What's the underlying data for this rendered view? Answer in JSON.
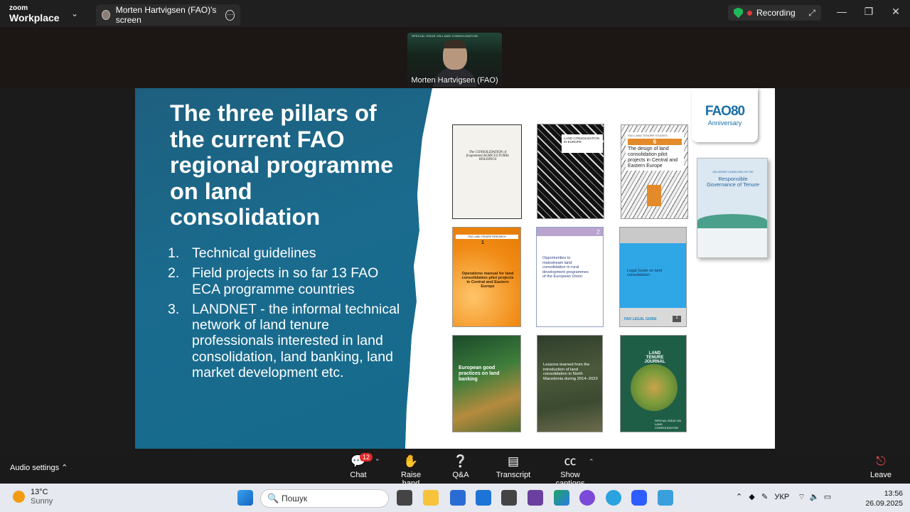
{
  "window": {
    "brand_line1": "zoom",
    "brand_line2": "Workplace",
    "tab_title": "Morten Hartvigsen (FAO)'s screen",
    "recording_label": "Recording"
  },
  "video": {
    "participant_name": "Morten Hartvigsen (FAO)",
    "header_text": "SPECIAL ISSUE ON LAND CONSOLIDATION"
  },
  "slide": {
    "title": "The three pillars of the current FAO regional programme on land consolidation",
    "list": [
      {
        "num": "1.",
        "text": "Technical guidelines"
      },
      {
        "num": "2.",
        "text": "Field projects in so far 13 FAO ECA programme countries"
      },
      {
        "num": "3.",
        "text": "LANDNET - the informal technical network of land tenure professionals interested in land consolidation, land banking, land market development etc."
      }
    ],
    "fao80_logo": "FAO80",
    "fao80_sub": "Anniversary",
    "books": {
      "b1_title": "The CONSOLIDATION of fragmented AGRICULTURAL HOLDINGS",
      "b2_title": "LAND CONSOLIDATION IN EUROPE",
      "b3_series": "FAO LAND TENURE STUDIES",
      "b3_num": "6",
      "b3_title": "The design of land consolidation pilot projects in Central and Eastern Europe",
      "b4_series": "FAO LAND TENURE RESEARCH",
      "b4_num": "1",
      "b4_title": "Operations manual for land consolidation pilot projects in Central and Eastern Europe",
      "b5_num": "2",
      "b5_title": "Opportunities to mainstream land consolidation in rural development programmes of the European Union",
      "b6_title": "Legal Guide on land consolidation",
      "b6_footer": "FAO LEGAL GUIDE",
      "b6_num": "1",
      "b7_title": "European good practices on land banking",
      "b8_title": "Lessons learned from the introduction of land consolidation in North Macedonia during 2014–2023",
      "b9_title": "LAND TENURE JOURNAL",
      "b9_footer": "SPECIAL ISSUE ON LAND CONSOLIDATION",
      "vg_title": "Responsible Governance of Tenure",
      "vg_head": "VOLUNTARY GUIDELINES ON THE"
    }
  },
  "toolbar": {
    "audio_settings": "Audio settings",
    "chat": "Chat",
    "chat_badge": "12",
    "raise_hand": "Raise hand",
    "qa": "Q&A",
    "transcript": "Transcript",
    "show_captions": "Show captions",
    "leave": "Leave"
  },
  "taskbar": {
    "temperature": "13°C",
    "weather": "Sunny",
    "search_placeholder": "Пошук",
    "language": "УКР",
    "time": "13:56",
    "date": "26.09.2025"
  },
  "colors": {
    "slide_blue": "#1a6b8e",
    "recording_dot": "#e03a3a",
    "shield_green": "#1eb85a",
    "chat_badge_red": "#e02828"
  }
}
